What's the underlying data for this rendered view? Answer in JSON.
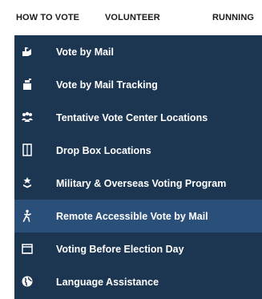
{
  "topnav": {
    "tabs": [
      "HOW TO VOTE",
      "VOLUNTEER",
      "RUNNING"
    ]
  },
  "menu": {
    "items": [
      {
        "label": "Vote by Mail",
        "icon": "mailbox-icon"
      },
      {
        "label": "Vote by Mail Tracking",
        "icon": "tracking-icon"
      },
      {
        "label": "Tentative Vote Center Locations",
        "icon": "people-group-icon"
      },
      {
        "label": "Drop Box Locations",
        "icon": "drop-box-icon"
      },
      {
        "label": "Military & Overseas Voting Program",
        "icon": "military-icon"
      },
      {
        "label": "Remote Accessible Vote by Mail",
        "icon": "accessibility-icon"
      },
      {
        "label": "Voting Before Election Day",
        "icon": "calendar-icon"
      },
      {
        "label": "Language Assistance",
        "icon": "globe-icon"
      }
    ],
    "active_index": 5
  },
  "colors": {
    "menu_bg": "#1c3550",
    "active_bg": "#2a4f78",
    "text": "#ffffff"
  }
}
